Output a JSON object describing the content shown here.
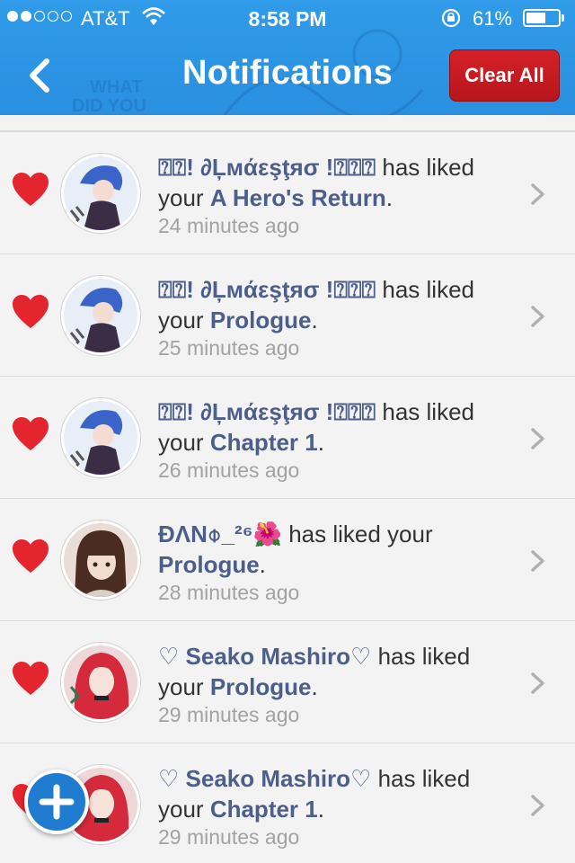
{
  "status_bar": {
    "carrier": "AT&T",
    "time": "8:58 PM",
    "battery_percent": "61%",
    "battery_level": 0.61
  },
  "header": {
    "title": "Notifications",
    "clear_all_label": "Clear All"
  },
  "notifications": [
    {
      "name": "⍰⍰! ∂Ļмάεşţяσ !⍰⍰⍰",
      "action": "has liked your",
      "target": "A Hero's Return",
      "time_ago": "24 minutes ago",
      "avatar": "blue-hair-avatar"
    },
    {
      "name": "⍰⍰! ∂Ļмάεşţяσ !⍰⍰⍰",
      "action": "has liked your",
      "target": "Prologue",
      "time_ago": "25 minutes ago",
      "avatar": "blue-hair-avatar"
    },
    {
      "name": "⍰⍰! ∂Ļмάεşţяσ !⍰⍰⍰",
      "action": "has liked your",
      "target": "Chapter 1",
      "time_ago": "26 minutes ago",
      "avatar": "blue-hair-avatar"
    },
    {
      "name": "ÐΛΝ⌽_²⁶🌺",
      "action": "has liked your",
      "target": "Prologue",
      "time_ago": "28 minutes ago",
      "avatar": "brown-hair-avatar"
    },
    {
      "name": "♡ Seako Mashiro♡",
      "action": "has liked your",
      "target": "Prologue",
      "time_ago": "29 minutes ago",
      "avatar": "red-hair-avatar"
    },
    {
      "name": "♡ Seako Mashiro♡",
      "action": "has liked your",
      "target": "Chapter 1",
      "time_ago": "29 minutes ago",
      "avatar": "red-hair-avatar"
    }
  ],
  "colors": {
    "header_blue": "#2f9be9",
    "clear_red": "#c81b22",
    "heart_red": "#e5252d",
    "name_blue": "#4b5f8a",
    "fab_blue": "#1f7cd0"
  }
}
